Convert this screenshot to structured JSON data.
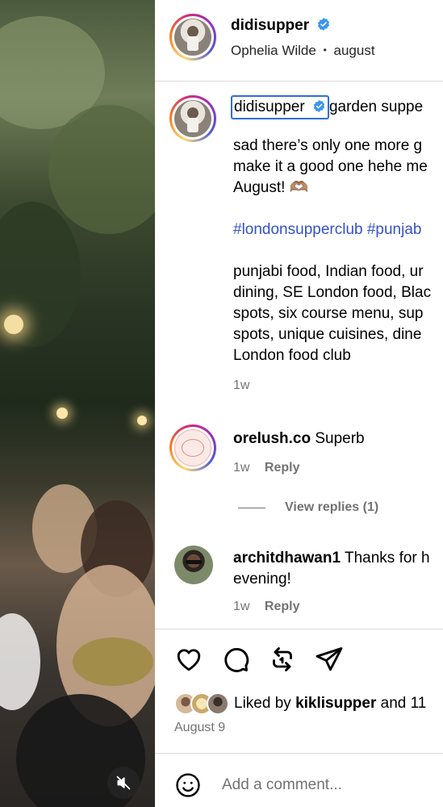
{
  "post": {
    "author": "didisupper",
    "author_verified": true,
    "subline_person": "Ophelia Wilde",
    "subline_sep": "•",
    "subline_audio": "august"
  },
  "caption": {
    "username": "didisupper",
    "line1_rest": "garden suppe",
    "line2": "sad there’s only one more g",
    "line3": "make it a good one hehe me",
    "line4": "August! 🫶🏽",
    "hashtags": "#londonsupperclub #punjab",
    "kw1": "punjabi food, Indian food, ur",
    "kw2": "dining, SE London food, Blac",
    "kw3": "spots, six course menu, sup",
    "kw4": "spots, unique cuisines, dine",
    "kw5": "London food club",
    "time": "1w"
  },
  "comments": [
    {
      "username": "orelush.co",
      "text": "Superb",
      "time": "1w",
      "reply_label": "Reply",
      "view_replies": "View replies (1)"
    },
    {
      "username": "architdhawan1",
      "text": "Thanks for h",
      "text2": "evening!",
      "time": "1w",
      "reply_label": "Reply"
    }
  ],
  "likes": {
    "prefix": "Liked by",
    "user": "kiklisupper",
    "suffix": "and 11"
  },
  "post_date": "August 9",
  "comment_input": {
    "placeholder": "Add a comment..."
  },
  "icons": {
    "like": "heart-icon",
    "comment": "comment-icon",
    "repost": "repost-icon",
    "share": "send-icon",
    "emoji": "emoji-icon",
    "mute": "speaker-muted-icon",
    "verified": "verified-badge-icon"
  },
  "colors": {
    "link": "#3552c8",
    "verified": "#3897f0",
    "muted": "#737373",
    "highlight_border": "#2f6fd6"
  }
}
